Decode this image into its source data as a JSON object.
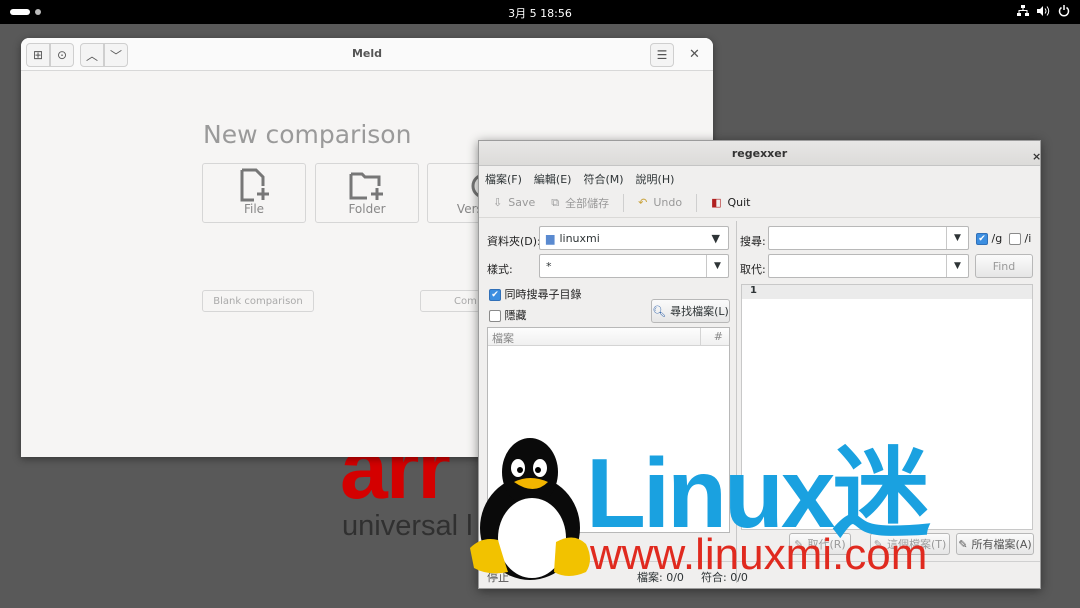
{
  "topbar": {
    "clock": "3月 5  18:56"
  },
  "background": {
    "brand_partial": "arr",
    "tagline_partial": "universal l"
  },
  "meld": {
    "title": "Meld",
    "heading": "New comparison",
    "tiles": [
      {
        "label": "File"
      },
      {
        "label": "Folder"
      },
      {
        "label": "Version"
      }
    ],
    "blank_button": "Blank comparison",
    "compare_button": "Com"
  },
  "regexxer": {
    "title": "regexxer",
    "menu": [
      "檔案(F)",
      "編輯(E)",
      "符合(M)",
      "說明(H)"
    ],
    "toolbar": {
      "save": "Save",
      "save_all": "全部儲存",
      "undo": "Undo",
      "quit": "Quit"
    },
    "folder_label": "資料夾(D):",
    "folder_value": "linuxmi",
    "pattern_label": "樣式:",
    "pattern_value": "*",
    "recursive_label": "同時搜尋子目錄",
    "hidden_label": "隱藏",
    "find_files_button": "尋找檔案(L)",
    "file_list": {
      "col_file": "檔案",
      "col_count": "#"
    },
    "search_label": "搜尋:",
    "replace_label": "取代:",
    "flag_g": "/g",
    "flag_i": "/i",
    "find_button": "Find",
    "line_number": "1",
    "replace_button": "取代(R)",
    "replace_file_button": "這個檔案(T)",
    "replace_all_button": "所有檔案(A)",
    "status_tab": "停止",
    "status_files": "檔案:  0/0",
    "status_matches": "符合:  0/0"
  },
  "watermark": {
    "logo_text": "Linux迷",
    "url": "www.linuxmi.com"
  }
}
